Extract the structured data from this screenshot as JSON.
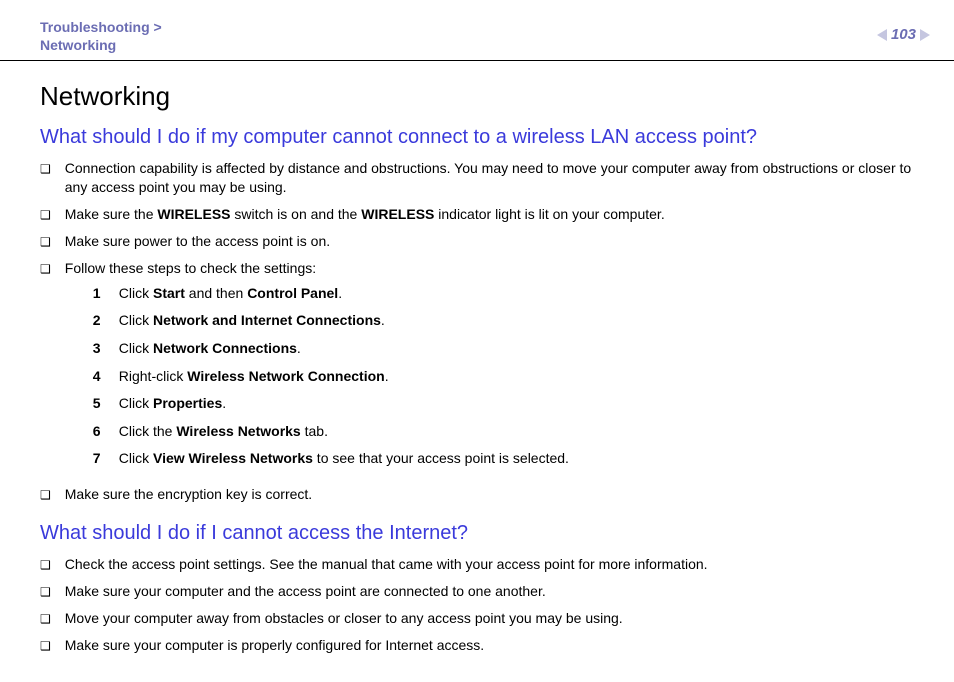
{
  "header": {
    "breadcrumb_line1": "Troubleshooting >",
    "breadcrumb_line2": "Networking",
    "page_number": "103"
  },
  "page_title": "Networking",
  "sections": [
    {
      "heading": "What should I do if my computer cannot connect to a wireless LAN access point?",
      "bullets": [
        {
          "html": "Connection capability is affected by distance and obstructions. You may need to move your computer away from obstructions or closer to any access point you may be using."
        },
        {
          "html": "Make sure the <b>WIRELESS</b> switch is on and the <b>WIRELESS</b> indicator light is lit on your computer."
        },
        {
          "html": "Make sure power to the access point is on."
        },
        {
          "html": "Follow these steps to check the settings:",
          "steps": [
            "Click <b>Start</b> and then <b>Control Panel</b>.",
            "Click <b>Network and Internet Connections</b>.",
            "Click <b>Network Connections</b>.",
            "Right-click <b>Wireless Network Connection</b>.",
            "Click <b>Properties</b>.",
            "Click the <b>Wireless Networks</b> tab.",
            "Click <b>View Wireless Networks</b> to see that your access point is selected."
          ]
        },
        {
          "html": "Make sure the encryption key is correct."
        }
      ]
    },
    {
      "heading": "What should I do if I cannot access the Internet?",
      "bullets": [
        {
          "html": "Check the access point settings. See the manual that came with your access point for more information."
        },
        {
          "html": "Make sure your computer and the access point are connected to one another."
        },
        {
          "html": "Move your computer away from obstacles or closer to any access point you may be using."
        },
        {
          "html": "Make sure your computer is properly configured for Internet access."
        }
      ]
    }
  ]
}
